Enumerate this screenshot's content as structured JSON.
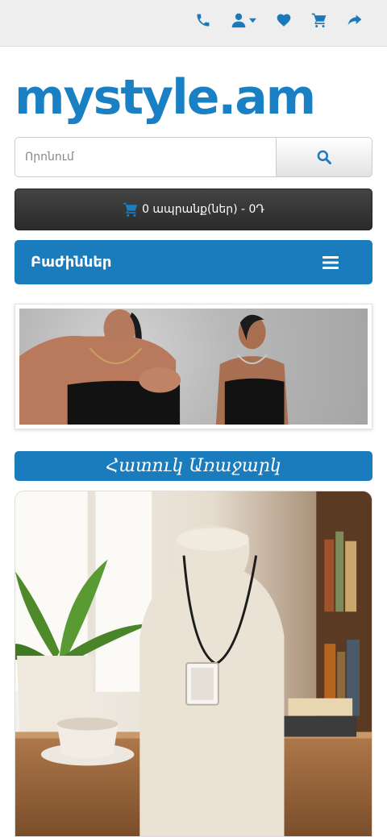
{
  "header": {
    "icons": [
      "phone-icon",
      "user-icon",
      "heart-icon",
      "cart-icon",
      "share-icon"
    ]
  },
  "logo": {
    "text": "mystyle.am"
  },
  "search": {
    "placeholder": "Որոնում",
    "button_icon": "search-icon"
  },
  "cart": {
    "label": "0 ապրանք(ներ) - 0Դ",
    "icon": "cart-icon"
  },
  "categories": {
    "label": "Բաժիններ",
    "icon": "menu-icon"
  },
  "special": {
    "label": "Հատուկ Առաջարկ"
  },
  "colors": {
    "accent": "#1a7cbd",
    "dark": "#333333",
    "topbar": "#eeeeee"
  }
}
